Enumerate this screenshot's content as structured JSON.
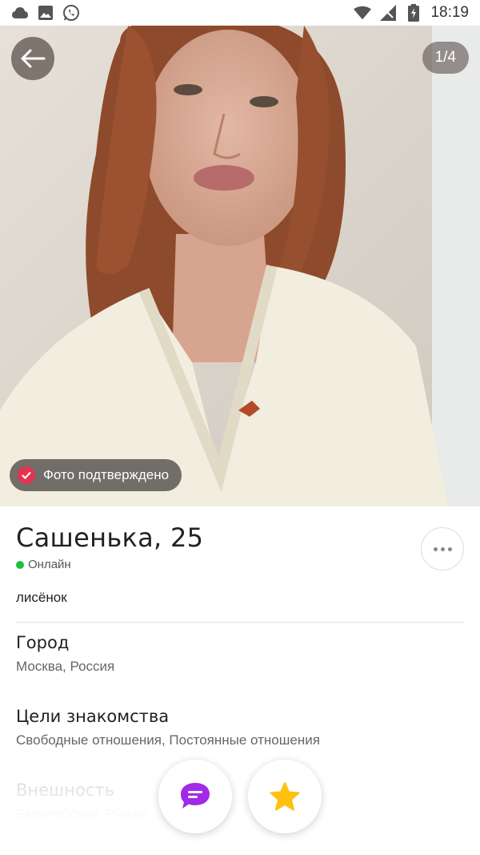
{
  "status_bar": {
    "time": "18:19",
    "left_icons": [
      "cloud-icon",
      "image-icon",
      "whatsapp-icon"
    ],
    "right_icons": [
      "wifi-icon",
      "signal-icon",
      "battery-charging-icon"
    ]
  },
  "photo": {
    "counter": "1/4",
    "verified_label": "Фото подтверждено",
    "back_icon": "arrow-left-icon"
  },
  "profile": {
    "name_age": "Сашенька, 25",
    "online_status": "Онлайн",
    "about": "лисёнок",
    "more_icon": "more-dots-icon"
  },
  "sections": [
    {
      "title": "Город",
      "value": "Москва, Россия"
    },
    {
      "title": "Цели знакомства",
      "value": "Свободные отношения, Постоянные отношения"
    },
    {
      "title": "Внешность",
      "value": "Европейская, Рыжие … Зеленые"
    }
  ],
  "actions": {
    "chat_icon": "chat-bubble-icon",
    "favorite_icon": "star-icon"
  },
  "colors": {
    "online": "#1fbf3c",
    "verified_badge": "#e5334f",
    "chat_purple": "#a12ae6",
    "star_yellow": "#ffc10f"
  }
}
